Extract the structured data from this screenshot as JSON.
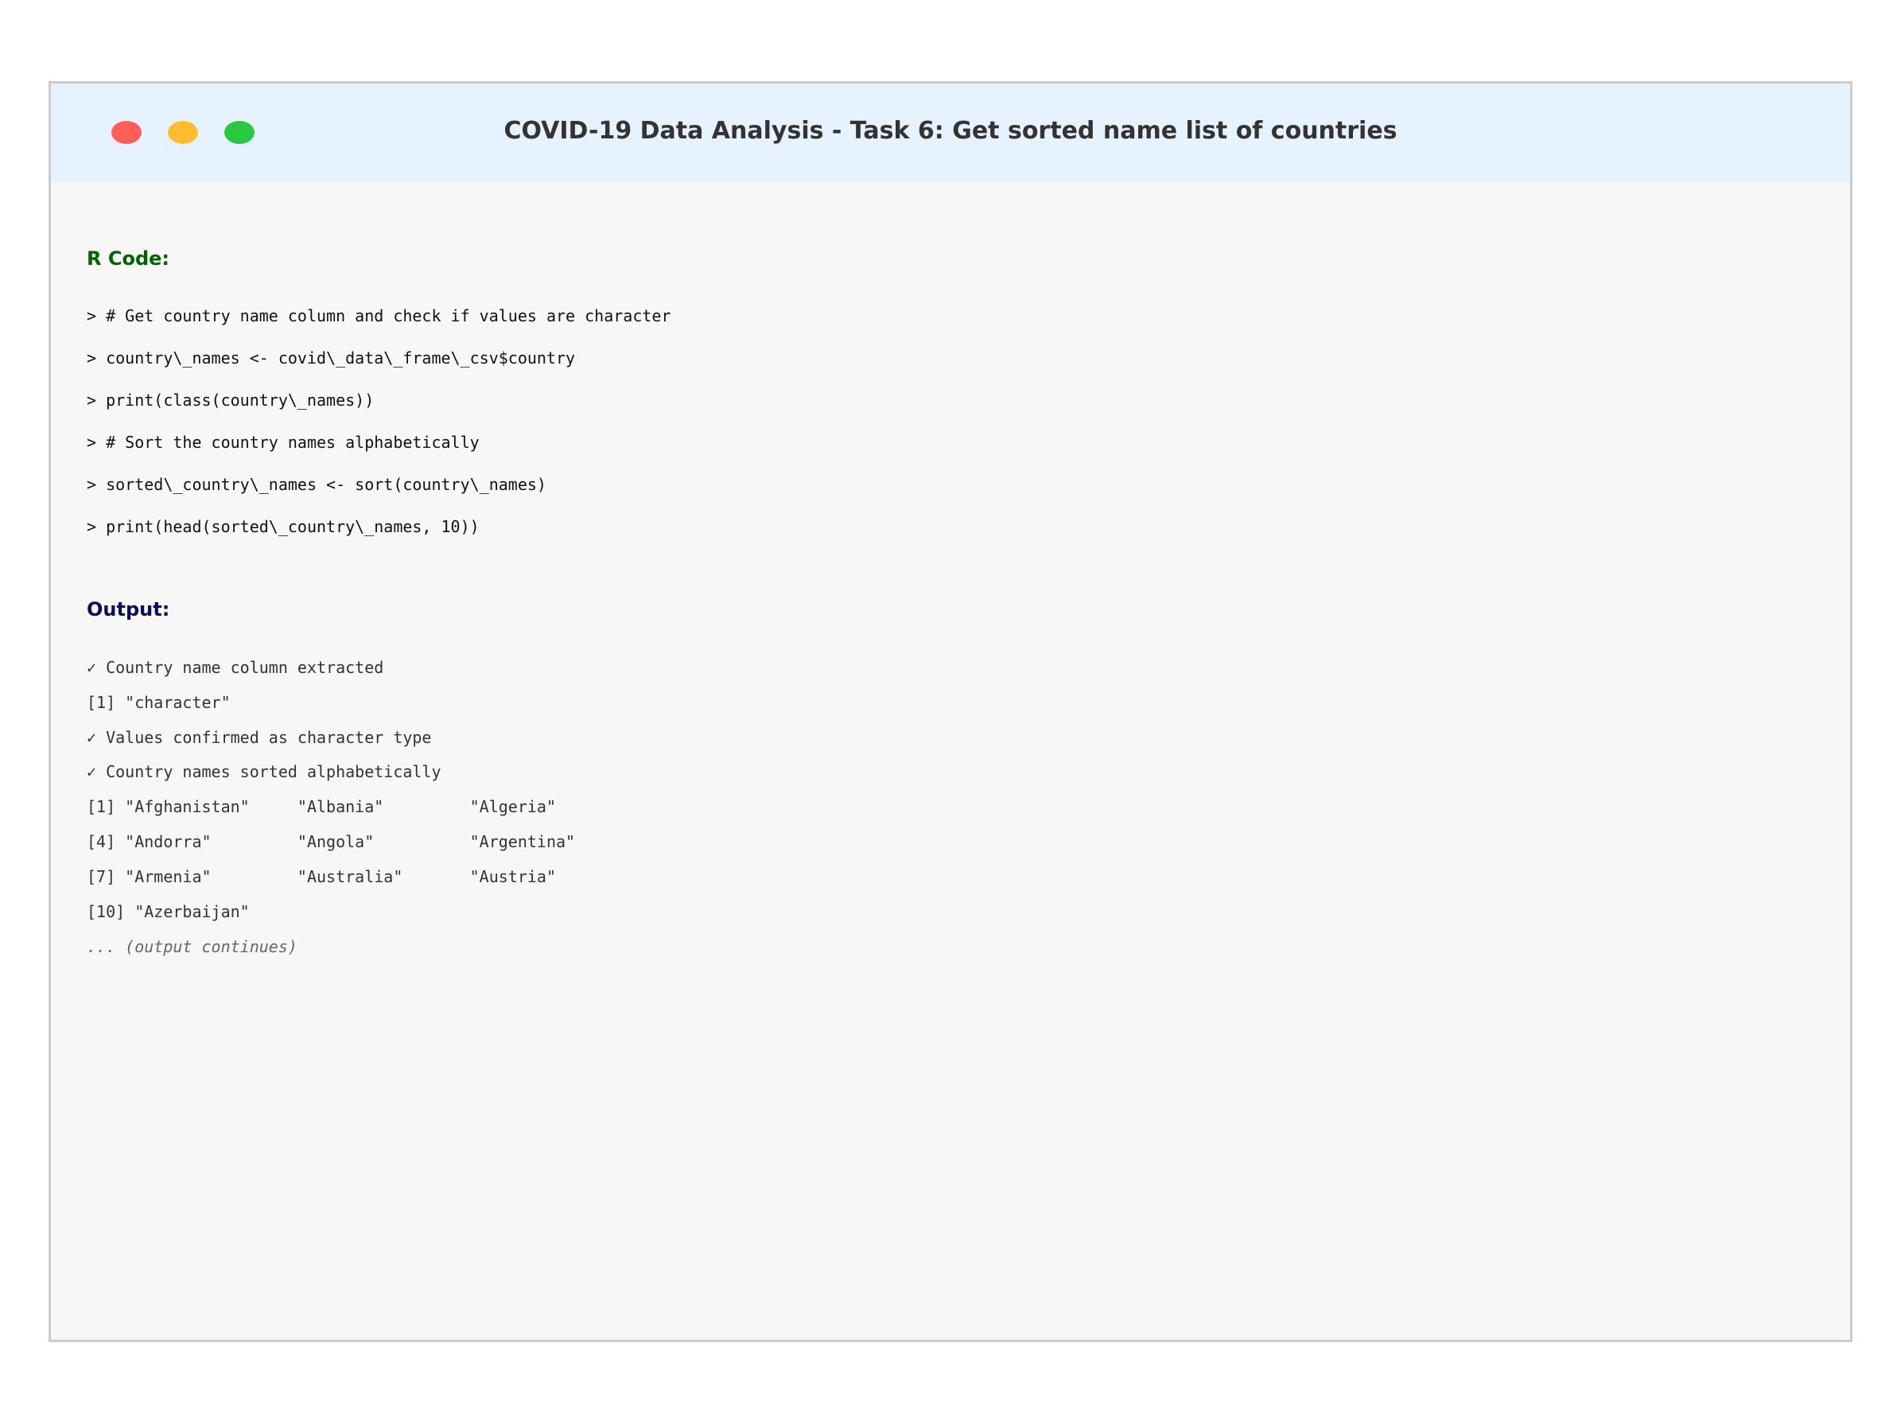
{
  "window": {
    "title": "COVID-19 Data Analysis - Task 6: Get sorted name list of countries",
    "controls": [
      {
        "name": "close",
        "color": "#ff5f57"
      },
      {
        "name": "minimize",
        "color": "#febc2e"
      },
      {
        "name": "maximize",
        "color": "#28c840"
      }
    ]
  },
  "code": {
    "label": "R Code:",
    "label_color": "#006400",
    "lines": [
      "> # Get country name column and check if values are character",
      "> country\\_names <- covid\\_data\\_frame\\_csv$country",
      "> print(class(country\\_names))",
      "> # Sort the country names alphabetically",
      "> sorted\\_country\\_names <- sort(country\\_names)",
      "> print(head(sorted\\_country\\_names, 10))"
    ]
  },
  "output": {
    "label": "Output:",
    "label_color": "#0b0b5e",
    "lines": [
      "✓ Country name column extracted",
      "[1] \"character\"",
      "✓ Values confirmed as character type",
      "✓ Country names sorted alphabetically",
      "[1] \"Afghanistan\"     \"Albania\"         \"Algeria\"",
      "[4] \"Andorra\"         \"Angola\"          \"Argentina\"",
      "[7] \"Armenia\"         \"Australia\"       \"Austria\"",
      "[10] \"Azerbaijan\""
    ],
    "continuation": "... (output continues)"
  }
}
